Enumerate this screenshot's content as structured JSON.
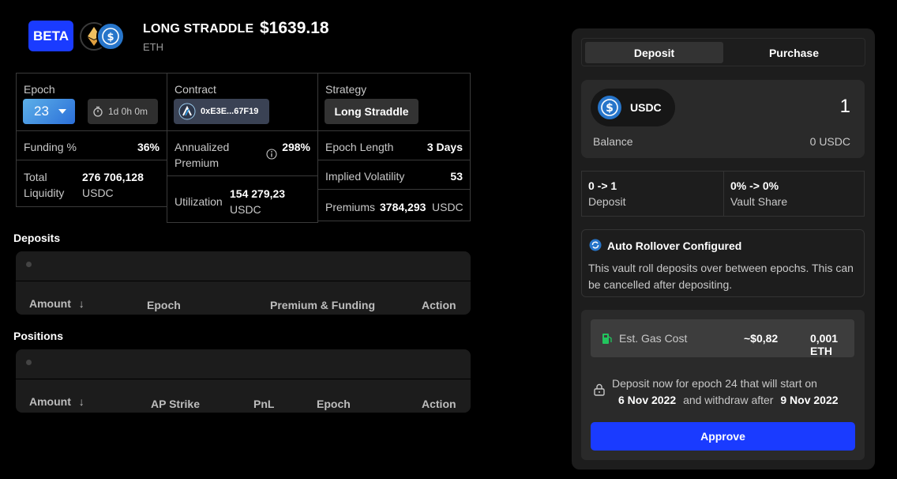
{
  "header": {
    "badge": "BETA",
    "title": "LONG STRADDLE",
    "subtitle": "ETH",
    "price": "$1639.18"
  },
  "stats": {
    "epoch_label": "Epoch",
    "epoch_value": "23",
    "timer": "1d 0h 0m",
    "contract_label": "Contract",
    "contract_address": "0xE3E...67F19",
    "strategy_label": "Strategy",
    "strategy_value": "Long Straddle",
    "funding_label": "Funding %",
    "funding_value": "36%",
    "annualized_label_1": "Annualized",
    "annualized_label_2": "Premium",
    "annualized_value": "298%",
    "epoch_length_label": "Epoch Length",
    "epoch_length_value": "3 Days",
    "total_liquidity_label_1": "Total",
    "total_liquidity_label_2": "Liquidity",
    "total_liquidity_value": "276 706,128",
    "total_liquidity_unit": "USDC",
    "implied_vol_label": "Implied Volatility",
    "implied_vol_value": "53",
    "utilization_label": "Utilization",
    "utilization_value": "154 279,23",
    "utilization_unit": "USDC",
    "premiums_label": "Premiums",
    "premiums_value": "3784,293",
    "premiums_unit": "USDC"
  },
  "deposits": {
    "title": "Deposits",
    "columns": [
      "Amount",
      "Epoch",
      "Premium & Funding",
      "Action"
    ]
  },
  "positions": {
    "title": "Positions",
    "columns": [
      "Amount",
      "AP Strike",
      "PnL",
      "Epoch",
      "Action"
    ]
  },
  "panel": {
    "tabs": [
      "Deposit",
      "Purchase"
    ],
    "active_tab": "Deposit",
    "asset": "USDC",
    "amount": "1",
    "balance_label": "Balance",
    "balance_value": "0 USDC",
    "deposit_change": "0 -> 1",
    "deposit_label": "Deposit",
    "share_change": "0% -> 0%",
    "share_label": "Vault Share",
    "rollover_title": "Auto Rollover Configured",
    "rollover_text": "This vault roll deposits over between epochs. This can be cancelled after depositing.",
    "gas_label": "Est. Gas Cost",
    "gas_usd": "~$0,82",
    "gas_eth": "0,001 ETH",
    "notice_line1": "Deposit now for epoch 24 that will start on",
    "notice_start": "6 Nov 2022",
    "notice_mid": "and withdraw after",
    "notice_end": "9 Nov 2022",
    "approve_label": "Approve"
  },
  "colors": {
    "accent": "#1a3bff",
    "usdc": "#2775ca",
    "background": "#000000",
    "panel": "#1d1d1d"
  }
}
